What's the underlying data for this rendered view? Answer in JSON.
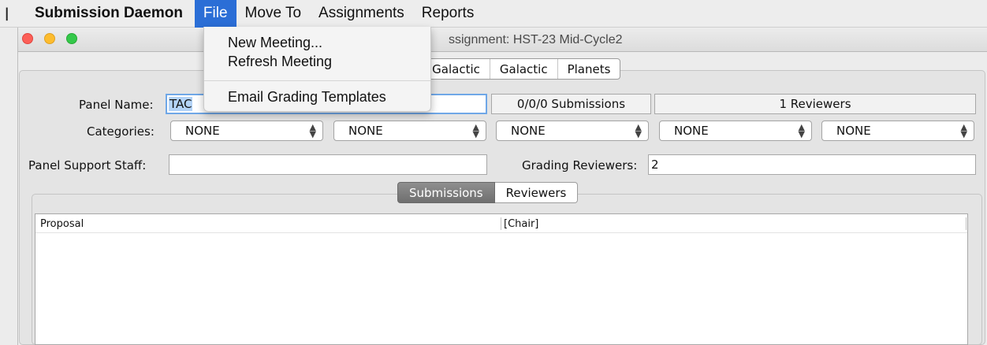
{
  "menubar": {
    "app_name": "Submission Daemon",
    "items": [
      "File",
      "Move To",
      "Assignments",
      "Reports"
    ],
    "active": "File"
  },
  "file_menu": {
    "items": [
      "New Meeting...",
      "Refresh Meeting",
      "Email Grading Templates"
    ]
  },
  "window": {
    "title": "ssignment: HST-23 Mid-Cycle2",
    "top_tabs": [
      "a-Galactic",
      "Galactic",
      "Planets"
    ]
  },
  "form": {
    "panel_name_label": "Panel Name:",
    "panel_name_value": "TAC",
    "submissions_count": "0/0/0 Submissions",
    "reviewers_count": "1 Reviewers",
    "categories_label": "Categories:",
    "categories": [
      "NONE",
      "NONE",
      "NONE",
      "NONE",
      "NONE"
    ],
    "support_staff_label": "Panel Support Staff:",
    "support_staff_value": "",
    "grading_reviewers_label": "Grading Reviewers:",
    "grading_reviewers_value": "2"
  },
  "inner_tabs": {
    "items": [
      "Submissions",
      "Reviewers"
    ],
    "selected": "Submissions"
  },
  "table": {
    "columns": [
      "Proposal",
      "[Chair]"
    ],
    "rows": []
  }
}
